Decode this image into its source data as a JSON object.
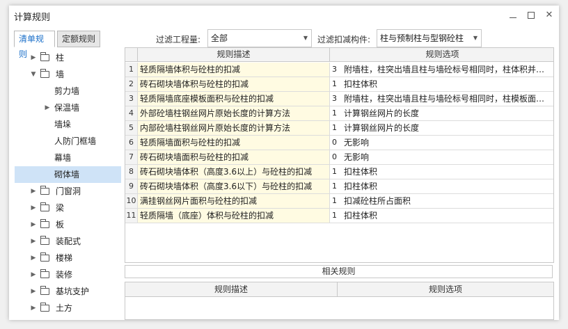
{
  "window": {
    "title": "计算规则"
  },
  "tabs": [
    {
      "label": "清单规则"
    },
    {
      "label": "定额规则"
    }
  ],
  "filters": {
    "quantity_label": "过滤工程量:",
    "quantity_value": "全部",
    "component_label": "过滤扣减构件:",
    "component_value": "柱与预制柱与型钢砼柱"
  },
  "tree": [
    {
      "label": "柱",
      "level": 0,
      "arrow": "collapsed",
      "folder": true
    },
    {
      "label": "墙",
      "level": 0,
      "arrow": "expanded",
      "folder": true
    },
    {
      "label": "剪力墙",
      "level": 1,
      "arrow": "none",
      "folder": false
    },
    {
      "label": "保温墙",
      "level": 1,
      "arrow": "collapsed",
      "folder": false
    },
    {
      "label": "墙垛",
      "level": 1,
      "arrow": "none",
      "folder": false
    },
    {
      "label": "人防门框墙",
      "level": 1,
      "arrow": "none",
      "folder": false
    },
    {
      "label": "幕墙",
      "level": 1,
      "arrow": "none",
      "folder": false
    },
    {
      "label": "砌体墙",
      "level": 1,
      "arrow": "none",
      "folder": false,
      "selected": true
    },
    {
      "label": "门窗洞",
      "level": 0,
      "arrow": "collapsed",
      "folder": true
    },
    {
      "label": "梁",
      "level": 0,
      "arrow": "collapsed",
      "folder": true
    },
    {
      "label": "板",
      "level": 0,
      "arrow": "collapsed",
      "folder": true
    },
    {
      "label": "装配式",
      "level": 0,
      "arrow": "collapsed",
      "folder": true
    },
    {
      "label": "楼梯",
      "level": 0,
      "arrow": "collapsed",
      "folder": true
    },
    {
      "label": "装修",
      "level": 0,
      "arrow": "collapsed",
      "folder": true
    },
    {
      "label": "基坑支护",
      "level": 0,
      "arrow": "collapsed",
      "folder": true
    },
    {
      "label": "土方",
      "level": 0,
      "arrow": "collapsed",
      "folder": true
    }
  ],
  "grid": {
    "headers": {
      "desc": "规则描述",
      "option": "规则选项"
    },
    "rows": [
      {
        "num": "1",
        "desc": "轻质隔墙体积与砼柱的扣减",
        "code": "3",
        "option": "附墙柱，柱突出墙且柱与墙砼标号相同时，柱体积并…"
      },
      {
        "num": "2",
        "desc": "砖石砌块墙体积与砼柱的扣减",
        "code": "1",
        "option": "扣柱体积"
      },
      {
        "num": "3",
        "desc": "轻质隔墙底座模板面积与砼柱的扣减",
        "code": "3",
        "option": "附墙柱，柱突出墙且柱与墙砼标号相同时，柱模板面…"
      },
      {
        "num": "4",
        "desc": "外部砼墙柱钢丝网片原始长度的计算方法",
        "code": "1",
        "option": "计算钢丝网片的长度"
      },
      {
        "num": "5",
        "desc": "内部砼墙柱钢丝网片原始长度的计算方法",
        "code": "1",
        "option": "计算钢丝网片的长度"
      },
      {
        "num": "6",
        "desc": "轻质隔墙面积与砼柱的扣减",
        "code": "0",
        "option": "无影响"
      },
      {
        "num": "7",
        "desc": "砖石砌块墙面积与砼柱的扣减",
        "code": "0",
        "option": "无影响"
      },
      {
        "num": "8",
        "desc": "砖石砌块墙体积（高度3.6以上）与砼柱的扣减",
        "code": "1",
        "option": "扣柱体积"
      },
      {
        "num": "9",
        "desc": "砖石砌块墙体积（高度3.6以下）与砼柱的扣减",
        "code": "1",
        "option": "扣柱体积"
      },
      {
        "num": "10",
        "desc": "满挂钢丝网片面积与砼柱的扣减",
        "code": "1",
        "option": "扣减砼柱所占面积"
      },
      {
        "num": "11",
        "desc": "轻质隔墙（底座）体积与砼柱的扣减",
        "code": "1",
        "option": "扣柱体积"
      }
    ]
  },
  "related": {
    "title": "相关规则",
    "headers": {
      "desc": "规则描述",
      "option": "规则选项"
    }
  }
}
